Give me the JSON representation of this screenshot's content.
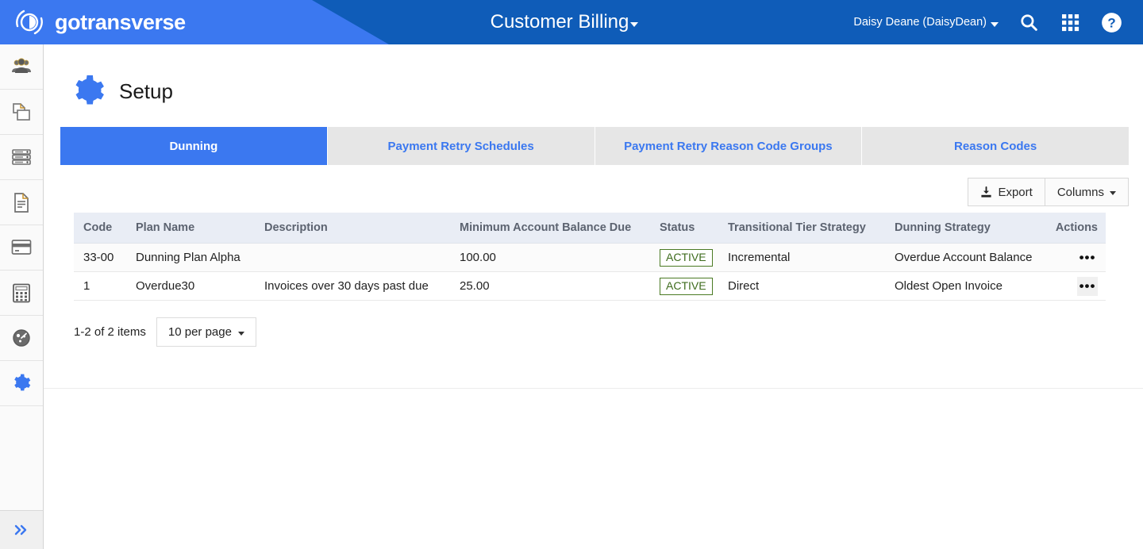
{
  "header": {
    "logo_text": "gotransverse",
    "logo_icon": "gotransverse-circle-logo-icon",
    "app_title": "Customer Billing",
    "app_title_caret": "chevron-down-icon",
    "user_name": "Daisy Deane (DaisyDean)",
    "icons": {
      "search": "search-icon",
      "apps": "apps-grid-icon",
      "help": "help-circle-icon"
    },
    "colors": {
      "wedge_blue": "#3b78f0",
      "bar_blue": "#0f5cb8"
    }
  },
  "sidebar": {
    "items": [
      {
        "name": "customers",
        "icon": "people-group-icon"
      },
      {
        "name": "products",
        "icon": "copy-documents-icon"
      },
      {
        "name": "accounts",
        "icon": "server-stack-icon"
      },
      {
        "name": "invoices",
        "icon": "document-file-icon"
      },
      {
        "name": "payments",
        "icon": "credit-card-icon"
      },
      {
        "name": "billing",
        "icon": "calculator-icon"
      },
      {
        "name": "dashboard",
        "icon": "gauge-dashboard-icon"
      },
      {
        "name": "setup",
        "icon": "gear-icon",
        "active": true
      }
    ],
    "expand_icon": "double-chevron-right-icon",
    "active_color": "#3b78f0"
  },
  "page": {
    "title": "Setup",
    "title_icon": "gear-icon"
  },
  "tabs": [
    {
      "label": "Dunning",
      "active": true
    },
    {
      "label": "Payment Retry Schedules",
      "active": false
    },
    {
      "label": "Payment Retry Reason Code Groups",
      "active": false
    },
    {
      "label": "Reason Codes",
      "active": false
    }
  ],
  "toolbar": {
    "export_label": "Export",
    "export_icon": "download-export-icon",
    "columns_label": "Columns",
    "columns_caret": "chevron-down-icon"
  },
  "table": {
    "columns": [
      "Code",
      "Plan Name",
      "Description",
      "Minimum Account Balance Due",
      "Status",
      "Transitional Tier Strategy",
      "Dunning Strategy",
      "Actions"
    ],
    "rows": [
      {
        "code": "33-00",
        "plan_name": "Dunning Plan Alpha",
        "description": "",
        "minimum_account_balance_due": "100.00",
        "status": "ACTIVE",
        "transitional_tier_strategy": "Incremental",
        "dunning_strategy": "Overdue Account Balance",
        "actions_icon": "ellipsis-horizontal-icon"
      },
      {
        "code": "1",
        "plan_name": "Overdue30",
        "description": "Invoices over 30 days past due",
        "minimum_account_balance_due": "25.00",
        "status": "ACTIVE",
        "transitional_tier_strategy": "Direct",
        "dunning_strategy": "Oldest Open Invoice",
        "actions_icon": "ellipsis-horizontal-icon"
      }
    ],
    "status_badge_color": "#3d6b1c"
  },
  "pagination": {
    "count_label": "1-2 of 2 items",
    "page_size_label": "10 per page",
    "page_size_caret": "chevron-down-icon"
  }
}
